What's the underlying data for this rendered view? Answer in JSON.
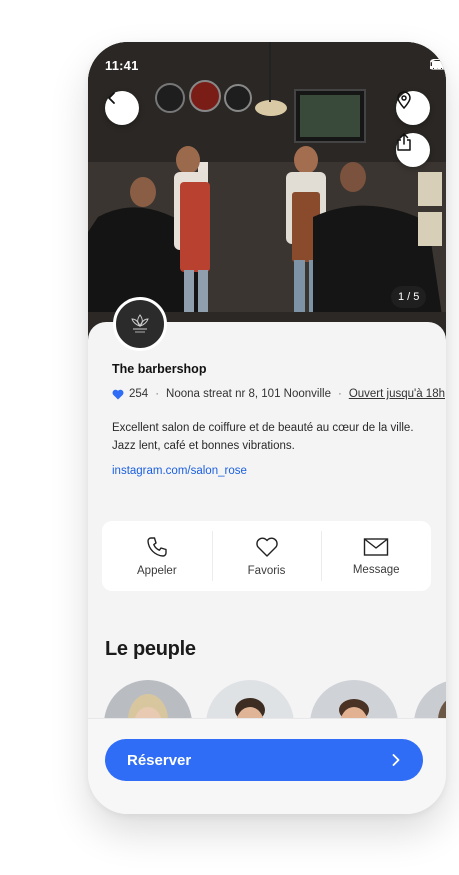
{
  "status_bar": {
    "time": "11:41"
  },
  "hero": {
    "photo_counter": "1 / 5"
  },
  "business": {
    "name": "The barbershop",
    "likes": "254",
    "address": "Noona streat nr 8, 101 Noonville",
    "hours": "Ouvert jusqu'à 18h",
    "description": "Excellent salon de coiffure et de beauté au cœur de la ville. Jazz lent, café et bonnes vibrations.",
    "link": "instagram.com/salon_rose"
  },
  "actions": [
    {
      "label": "Appeler",
      "icon": "phone-icon"
    },
    {
      "label": "Favoris",
      "icon": "heart-outline-icon"
    },
    {
      "label": "Message",
      "icon": "mail-icon"
    }
  ],
  "people_section": {
    "title": "Le peuple"
  },
  "cta": {
    "label": "Réserver"
  },
  "colors": {
    "accent": "#2f6df6",
    "link": "#1a5fe0",
    "heart": "#2f6df6"
  }
}
